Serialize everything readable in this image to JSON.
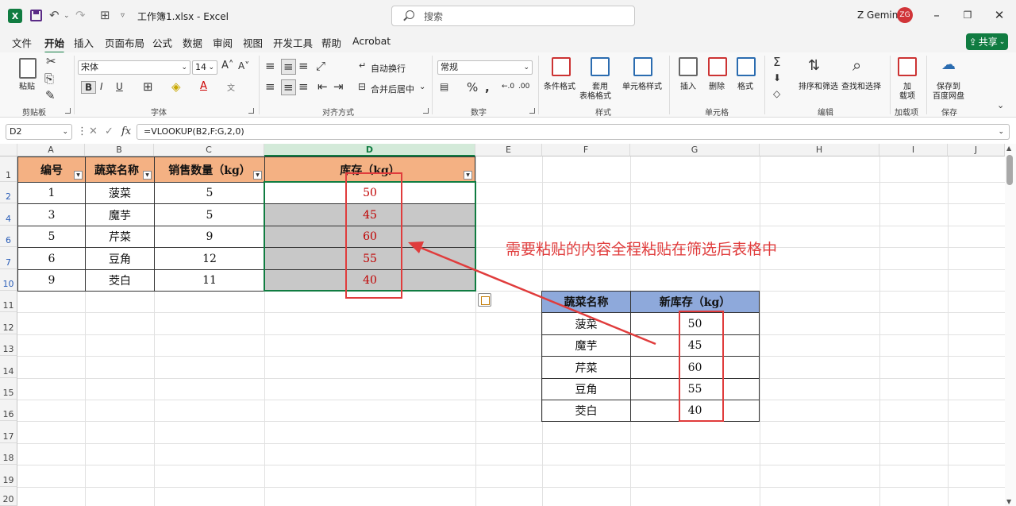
{
  "titlebar": {
    "file_name": "工作簿1.xlsx - Excel",
    "search_placeholder": "搜索",
    "user_name": "Z Gemini",
    "user_initials": "ZG"
  },
  "menu": {
    "tabs": [
      "文件",
      "开始",
      "插入",
      "页面布局",
      "公式",
      "数据",
      "审阅",
      "视图",
      "开发工具",
      "帮助",
      "Acrobat"
    ],
    "active_tab": "开始",
    "share_label": "共享"
  },
  "ribbon": {
    "clipboard": {
      "paste": "粘贴",
      "label": "剪贴板"
    },
    "font": {
      "name": "宋体",
      "size": "14",
      "label": "字体"
    },
    "alignment": {
      "wrap": "自动换行",
      "merge": "合并后居中",
      "label": "对齐方式"
    },
    "number": {
      "format": "常规",
      "label": "数字"
    },
    "styles": {
      "conditional": "条件格式",
      "table_1": "套用",
      "table_2": "表格格式",
      "cell_styles": "单元格样式",
      "label": "样式"
    },
    "cells": {
      "insert": "插入",
      "delete": "删除",
      "format": "格式",
      "label": "单元格"
    },
    "editing": {
      "sort_filter": "排序和筛选",
      "find_select": "查找和选择",
      "label": "编辑"
    },
    "addins": {
      "line1": "加",
      "line2": "载项",
      "label": "加载项"
    },
    "save": {
      "line1": "保存到",
      "line2": "百度网盘",
      "label": "保存"
    }
  },
  "formula_bar": {
    "cell_ref": "D2",
    "formula": "=VLOOKUP(B2,F:G,2,0)"
  },
  "grid": {
    "columns": [
      "A",
      "B",
      "C",
      "D",
      "E",
      "F",
      "G",
      "H",
      "I",
      "J"
    ],
    "selected_column": "D",
    "rows": [
      "1",
      "2",
      "4",
      "6",
      "7",
      "10",
      "11",
      "12",
      "13",
      "14",
      "15",
      "16",
      "17",
      "18",
      "19",
      "20"
    ],
    "filtered_rows": [
      "2",
      "4",
      "6",
      "7",
      "10"
    ]
  },
  "table1": {
    "headers": [
      "编号",
      "蔬菜名称",
      "销售数量（kg）",
      "库存（kg）"
    ],
    "rows": [
      [
        "1",
        "菠菜",
        "5",
        "50"
      ],
      [
        "3",
        "魔芋",
        "5",
        "45"
      ],
      [
        "5",
        "芹菜",
        "9",
        "60"
      ],
      [
        "6",
        "豆角",
        "12",
        "55"
      ],
      [
        "9",
        "茭白",
        "11",
        "40"
      ]
    ]
  },
  "table2": {
    "headers": [
      "蔬菜名称",
      "新库存（kg）"
    ],
    "rows": [
      [
        "菠菜",
        "50"
      ],
      [
        "魔芋",
        "45"
      ],
      [
        "芹菜",
        "60"
      ],
      [
        "豆角",
        "55"
      ],
      [
        "茭白",
        "40"
      ]
    ]
  },
  "annotation_text": "需要粘贴的内容全程粘贴在筛选后表格中",
  "colors": {
    "excel_green": "#107c41",
    "header_orange": "#f4b183",
    "header_blue": "#8ea9db",
    "highlight_red": "#e03c3c",
    "gray_fill": "#c8c8c8"
  }
}
